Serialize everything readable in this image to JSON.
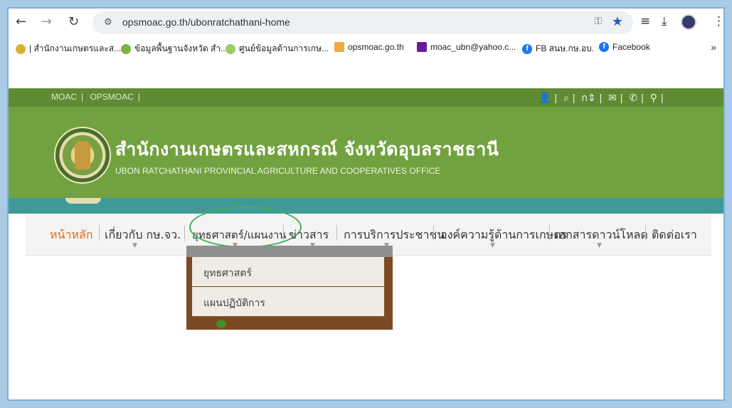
{
  "browser": {
    "url": "opsmoac.go.th/ubonratchathani-home",
    "bookmarks": [
      {
        "label": "| สำนักงานเกษตรและส...",
        "icon": "site-icon"
      },
      {
        "label": "ข้อมูลพื้นฐานจังหวัด สำ...",
        "icon": "globe-icon"
      },
      {
        "label": "ศูนย์ข้อมูลด้านการเกษ...",
        "icon": "leaf-icon"
      },
      {
        "label": "opsmoac.go.th",
        "icon": "mail-icon"
      },
      {
        "label": "moac_ubn@yahoo.c...",
        "icon": "mail-icon"
      },
      {
        "label": "FB สนษ.กษ.อบ.",
        "icon": "facebook-icon"
      },
      {
        "label": "Facebook",
        "icon": "facebook-icon"
      }
    ],
    "more_label": "»"
  },
  "topbar": {
    "left_links": [
      "MOAC",
      "OPSMOAC"
    ],
    "right_icons": [
      "user-icon",
      "search-icon",
      "font-size-icon",
      "mail-icon",
      "phone-icon",
      "location-icon"
    ]
  },
  "header": {
    "title": "สำนักงานเกษตรและสหกรณ์ จังหวัดอุบลราชธานี",
    "subtitle": "UBON RATCHATHANI PROVINCIAL AGRICULTURE AND COOPERATIVES OFFICE"
  },
  "nav": {
    "items": [
      {
        "label": "หน้าหลัก",
        "active": true
      },
      {
        "label": "เกี่ยวกับ กษ.จว.",
        "active": false
      },
      {
        "label": "ยุทธศาสตร์/แผนงาน",
        "active": false
      },
      {
        "label": "ข่าวสาร",
        "active": false
      },
      {
        "label": "การบริการประชาชน",
        "active": false
      },
      {
        "label": "องค์ความรู้ด้านการเกษตร",
        "active": false
      },
      {
        "label": "เอกสารดาวน์โหลด",
        "active": false
      },
      {
        "label": "ติดต่อเรา",
        "active": false
      }
    ]
  },
  "dropdown": {
    "items": [
      "ยุทธศาสตร์",
      "แผนปฏิบัติการ"
    ]
  },
  "colors": {
    "header_green": "#72a23f",
    "topbar_green": "#5e8b34",
    "teal_band": "#3f9a97",
    "active_nav": "#e06a1a",
    "dropdown_bg": "#7b4a25"
  }
}
